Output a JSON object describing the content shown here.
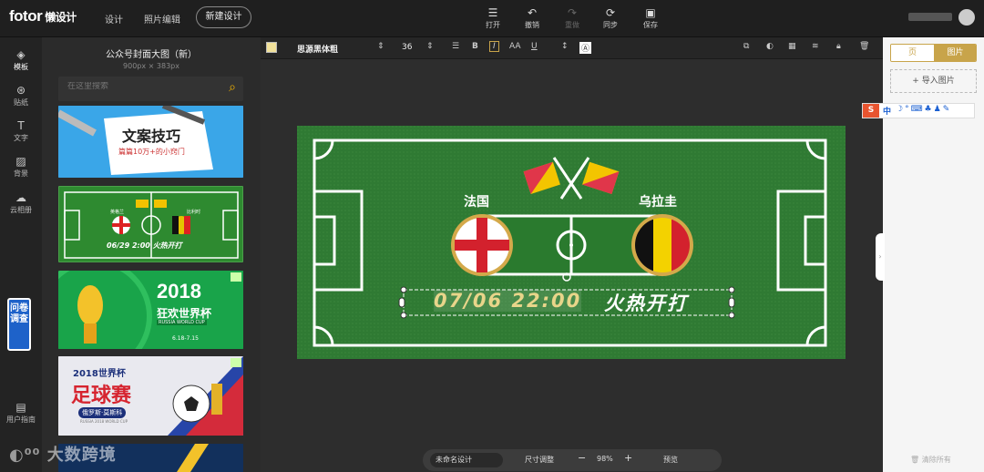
{
  "app": {
    "logo": "fotor",
    "logo_cn": "懒设计",
    "nav": {
      "design": "设计",
      "photo_edit": "照片编辑"
    },
    "new_design": "新建设计"
  },
  "toolbar": {
    "open": "打开",
    "undo": "撤销",
    "redo": "重做",
    "sync": "同步",
    "save": "保存"
  },
  "iconbar": {
    "template": "模板",
    "sticker": "贴纸",
    "text": "文字",
    "background": "背景",
    "cloud": "云相册",
    "survey": "问卷调查",
    "guide": "用户指南"
  },
  "panel": {
    "title": "公众号封面大图（新）",
    "size": "900px × 383px",
    "search_placeholder": "在这里搜索",
    "thumbs": {
      "t1_title": "文案技巧",
      "t1_sub": "篇篇10万+的小窍门",
      "t2_left": "英格兰",
      "t2_right": "比利时",
      "t2_time": "06/29 2:00 火热开打",
      "t3_year": "2018",
      "t3_title": "狂欢世界杯",
      "t3_sub": "RUSSIA WORLD CUP",
      "t3_date": "6.18-7.15",
      "t4_year": "2018世界杯",
      "t4_title": "足球赛",
      "t4_sub": "俄罗斯·莫斯科",
      "t4_en": "RUSSIA 2018 WORLD CUP"
    }
  },
  "format": {
    "font": "思源黑体粗",
    "size": "36",
    "bold": "B",
    "italic": "I",
    "caps": "AA",
    "underline": "U"
  },
  "canvas": {
    "team_left": "法国",
    "team_right": "乌拉圭",
    "match_time": "07/06 22:00",
    "headline": "火热开打"
  },
  "sidebar": {
    "tab_page": "页",
    "tab_image": "图片",
    "import": "+ 导入图片",
    "clear": "清除所有"
  },
  "ime": {
    "lang": "中"
  },
  "zoombar": {
    "name": "未命名设计",
    "resize": "尺寸调整",
    "minus": "−",
    "zoom": "98%",
    "plus": "+",
    "preview": "预览"
  },
  "watermark": "大数跨境",
  "colors": {
    "accent": "#c8a44a",
    "field": "#2f7a33",
    "survey": "#1e62c9"
  }
}
